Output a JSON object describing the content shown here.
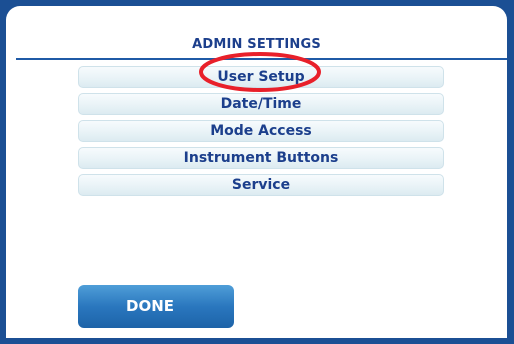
{
  "title": "ADMIN SETTINGS",
  "menu": {
    "items": [
      {
        "label": "User Setup"
      },
      {
        "label": "Date/Time"
      },
      {
        "label": "Mode Access"
      },
      {
        "label": "Instrument Buttons"
      },
      {
        "label": "Service"
      }
    ]
  },
  "done_label": "DONE",
  "colors": {
    "frame": "#1b4f94",
    "text": "#1c3f8c",
    "highlight": "#e8202a",
    "button": "#2a77be"
  }
}
